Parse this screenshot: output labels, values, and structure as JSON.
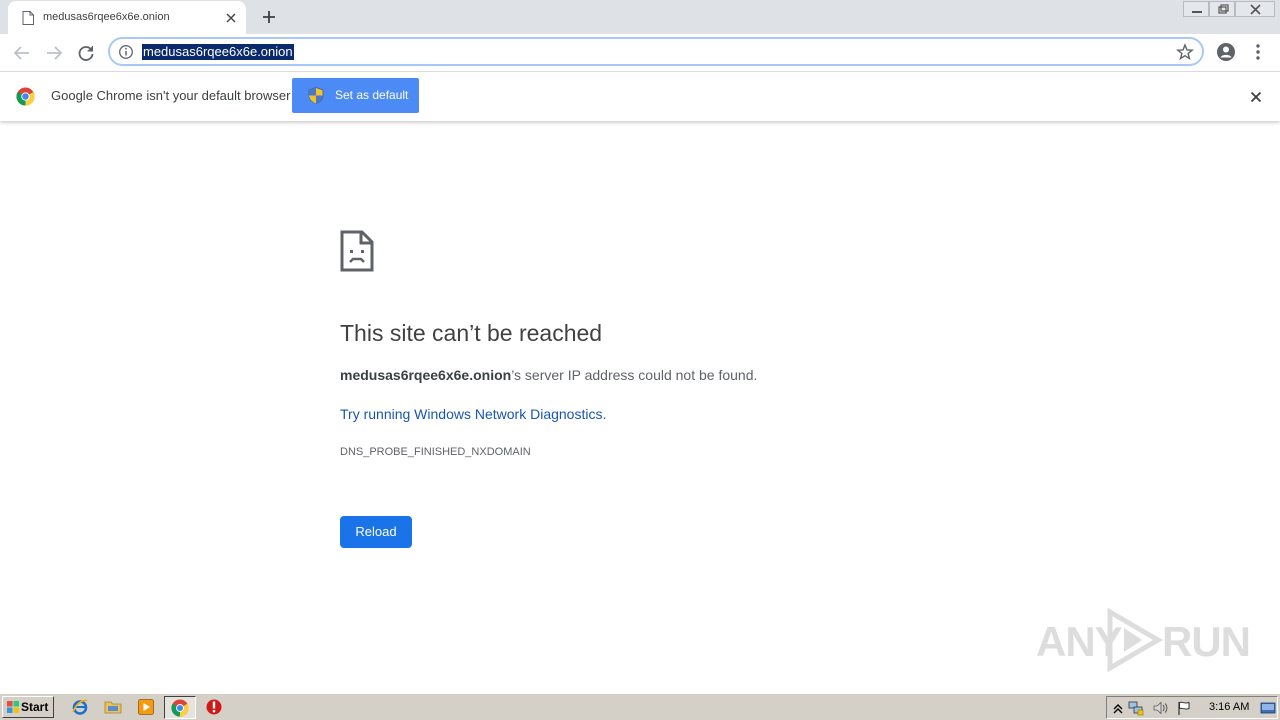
{
  "tab": {
    "title": "medusas6rqee6x6e.onion"
  },
  "omnibox": {
    "url": "medusas6rqee6x6e.onion"
  },
  "infobar": {
    "message": "Google Chrome isn't your default browser",
    "set_default_label": "Set as default"
  },
  "error_page": {
    "title": "This site can’t be reached",
    "host": "medusas6rqee6x6e.onion",
    "host_suffix": "’s server IP address could not be found.",
    "diagnostics_link": "Try running Windows Network Diagnostics.",
    "error_code": "DNS_PROBE_FINISHED_NXDOMAIN",
    "reload_label": "Reload"
  },
  "watermark": {
    "left": "ANY",
    "right": "RUN"
  },
  "taskbar": {
    "start_label": "Start",
    "clock": "3:16 AM",
    "pinned_icons": [
      "internet-explorer-icon",
      "folder-icon",
      "media-player-icon",
      "chrome-icon",
      "antivirus-icon"
    ]
  },
  "colors": {
    "accent": "#1a73e8",
    "infobar_button": "#4c8bf5",
    "link": "#1a55b0",
    "tabstrip": "#dee1e6"
  }
}
